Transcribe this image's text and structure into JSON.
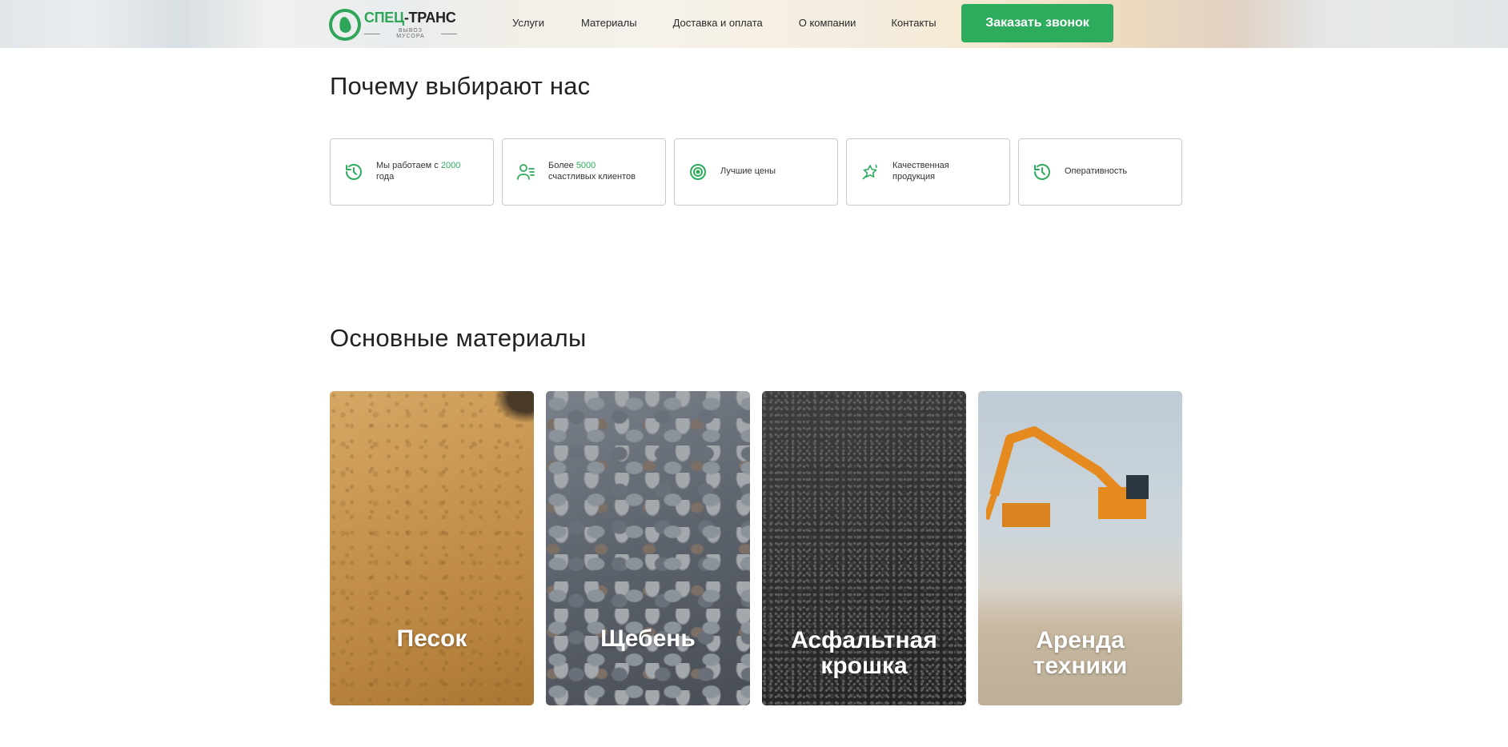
{
  "header": {
    "logo": {
      "name_part1": "СПЕЦ",
      "name_part2": "-ТРАНС",
      "subtitle": "ВЫВОЗ МУСОРА"
    },
    "nav": [
      {
        "label": "Услуги"
      },
      {
        "label": "Материалы"
      },
      {
        "label": "Доставка и оплата"
      },
      {
        "label": "О компании"
      },
      {
        "label": "Контакты"
      }
    ],
    "cta_label": "Заказать звонок"
  },
  "why": {
    "title": "Почему выбирают нас",
    "features": [
      {
        "icon": "history-icon",
        "prefix": "Мы работаем с ",
        "highlight": "2000",
        "suffix": "года"
      },
      {
        "icon": "users-icon",
        "prefix": "Более ",
        "highlight": "5000",
        "suffix": "счастливых клиентов"
      },
      {
        "icon": "target-icon",
        "prefix": "Лучшие цены",
        "highlight": "",
        "suffix": ""
      },
      {
        "icon": "stars-icon",
        "prefix": "Качественная",
        "highlight": "",
        "suffix": "продукция"
      },
      {
        "icon": "history-icon",
        "prefix": "Оперативность",
        "highlight": "",
        "suffix": ""
      }
    ]
  },
  "materials": {
    "title": "Основные материалы",
    "items": [
      {
        "line1": "Песок",
        "line2": ""
      },
      {
        "line1": "Щебень",
        "line2": ""
      },
      {
        "line1": "Асфальтная",
        "line2": "крошка"
      },
      {
        "line1": "Аренда",
        "line2": "техники"
      }
    ]
  },
  "colors": {
    "accent": "#2eac5d",
    "text": "#222222",
    "border": "#c9c9c9"
  }
}
